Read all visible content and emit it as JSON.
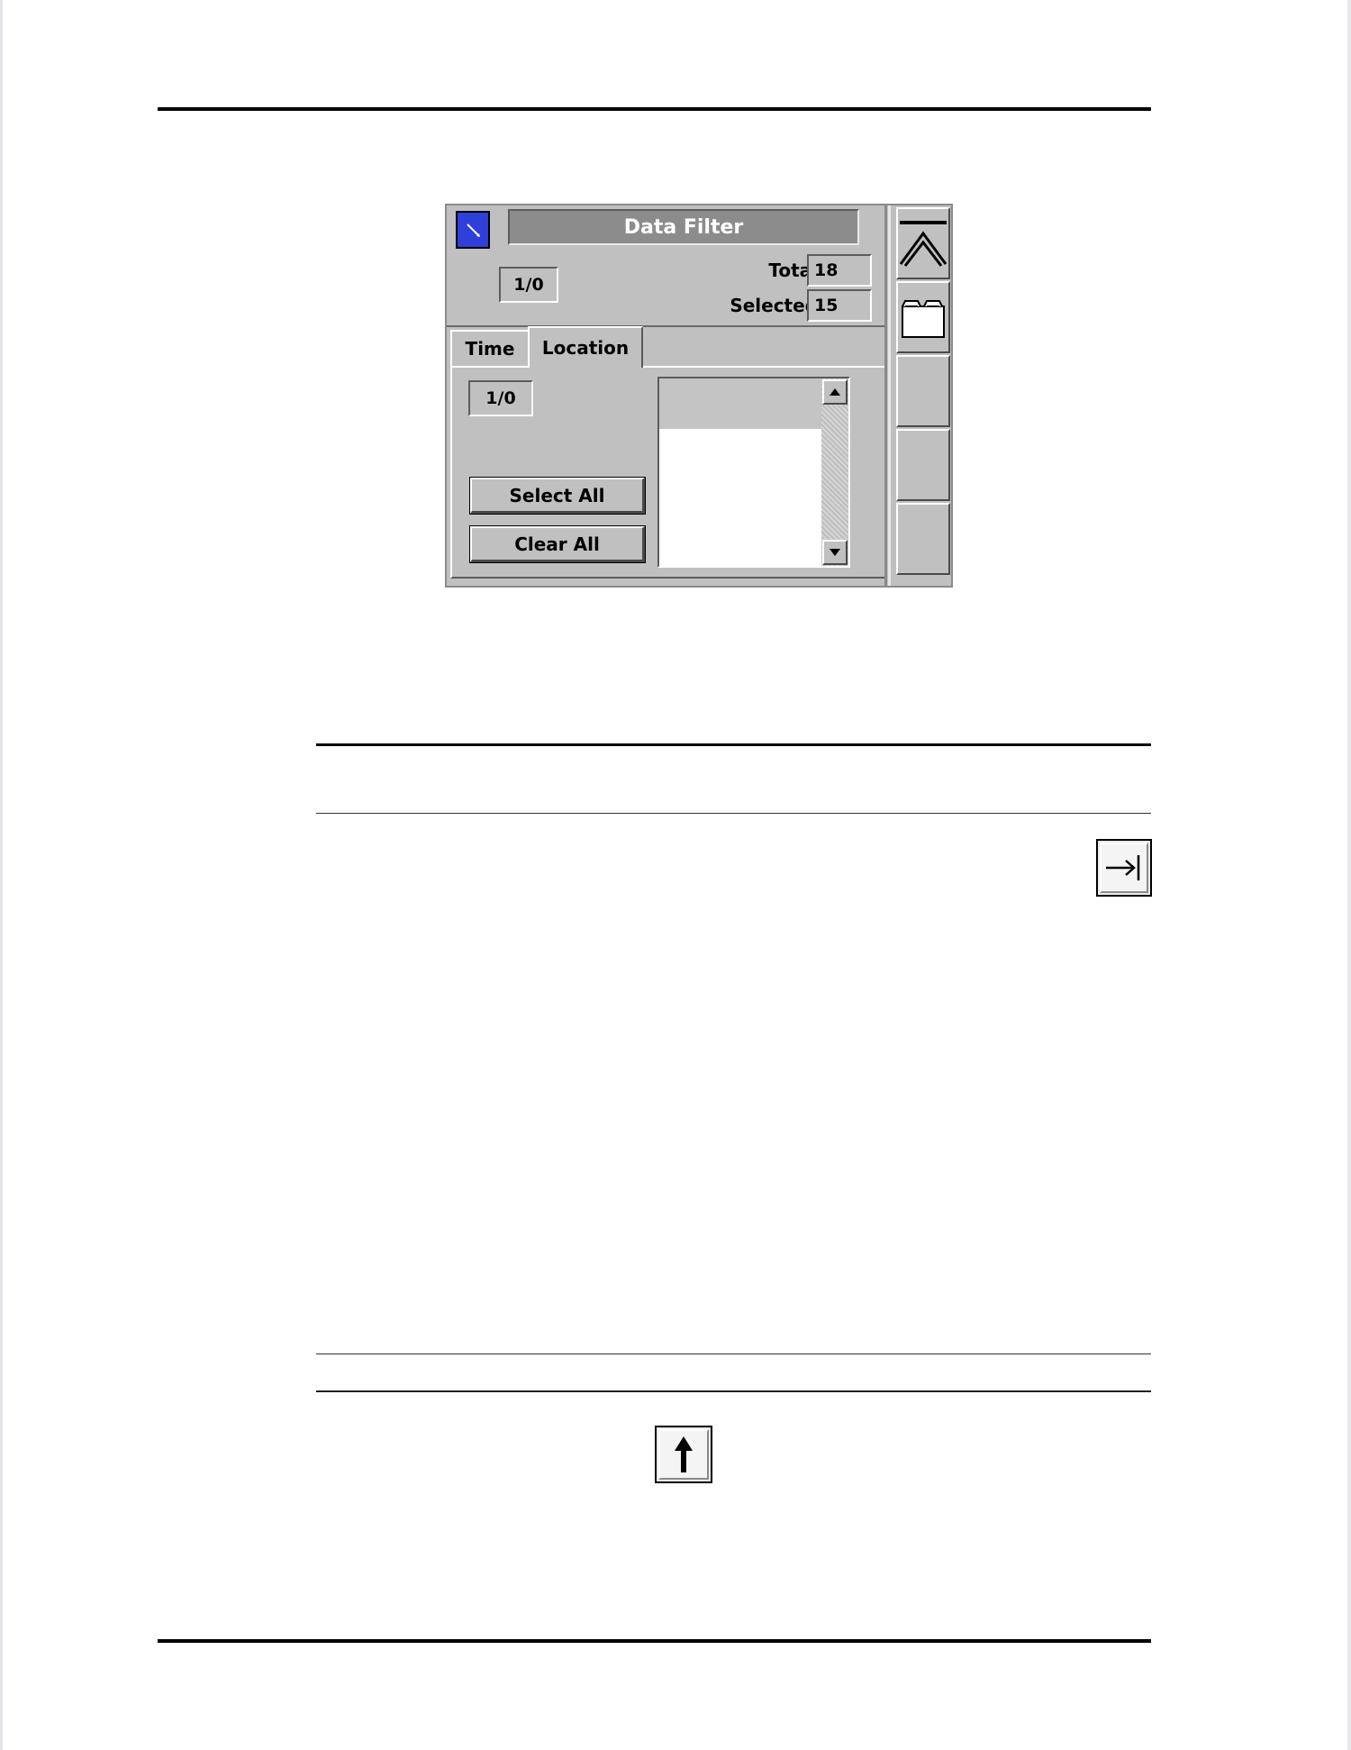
{
  "screen": {
    "title": "Data Filter",
    "io_indicator": "1/0",
    "total_label": "Total:",
    "total_value": "18",
    "selected_label": "Selected:",
    "selected_value": "15",
    "tabs": [
      {
        "label": "Time",
        "active": false
      },
      {
        "label": "Location",
        "active": true
      }
    ],
    "panel_indicator": "1/0",
    "select_all_label": "Select All",
    "clear_all_label": "Clear All",
    "sidebar_icons": [
      "double-chevron-up-icon",
      "folder-icon",
      "",
      "",
      ""
    ]
  },
  "icons": {
    "tab_right": "tab-right-arrow-icon",
    "up_arrow": "up-arrow-icon"
  }
}
